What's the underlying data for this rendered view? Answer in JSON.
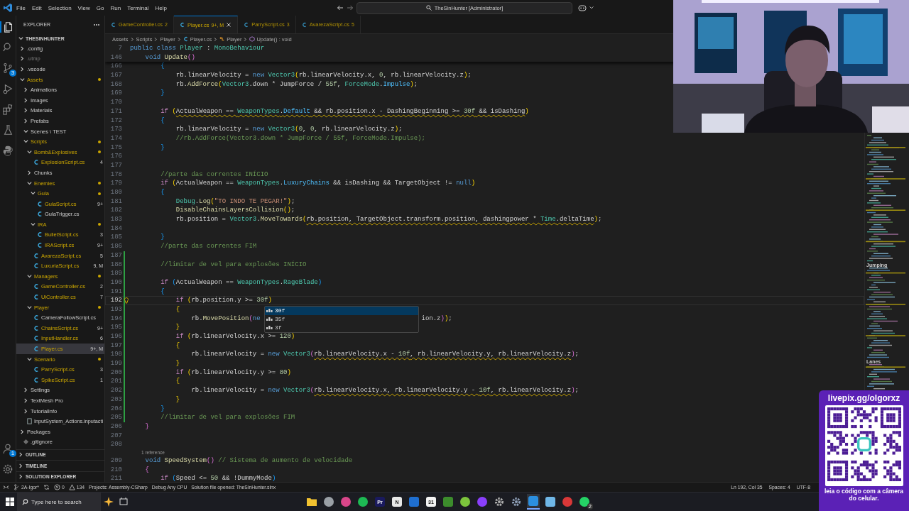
{
  "titlebar": {
    "menu": [
      "File",
      "Edit",
      "Selection",
      "View",
      "Go",
      "Run",
      "Terminal",
      "Help"
    ],
    "command_center": "TheSinHunter [Administrator]"
  },
  "activity_bar": {
    "top": [
      {
        "kind": "explorer",
        "selected": true
      },
      {
        "kind": "search",
        "selected": false
      },
      {
        "kind": "source-control",
        "selected": false,
        "badge": "3"
      },
      {
        "kind": "run-debug",
        "selected": false
      },
      {
        "kind": "extensions",
        "selected": false
      },
      {
        "kind": "testing",
        "selected": false
      },
      {
        "kind": "python",
        "selected": false
      }
    ],
    "bottom": [
      {
        "kind": "account",
        "badge": "1"
      },
      {
        "kind": "settings"
      }
    ]
  },
  "explorer": {
    "title": "EXPLORER",
    "project": "THESINHUNTER",
    "items": [
      {
        "label": ".config",
        "kind": "folder",
        "expanded": false,
        "warning": false,
        "ignored": false,
        "dot": false,
        "selected": false
      },
      {
        "label": ".utmp",
        "kind": "folder",
        "expanded": false,
        "warning": false,
        "ignored": true,
        "dot": false,
        "selected": false
      },
      {
        "label": ".vscode",
        "kind": "folder",
        "expanded": false,
        "warning": false,
        "ignored": false,
        "dot": false,
        "selected": false
      },
      {
        "label": "Assets",
        "kind": "folder",
        "expanded": true,
        "warning": true,
        "ignored": false,
        "dot": true,
        "selected": false,
        "children": [
          {
            "label": "Animations",
            "kind": "folder",
            "expanded": false,
            "warning": false,
            "ignored": false,
            "dot": false,
            "selected": false
          },
          {
            "label": "Images",
            "kind": "folder",
            "expanded": false,
            "warning": false,
            "ignored": false,
            "dot": false,
            "selected": false
          },
          {
            "label": "Materials",
            "kind": "folder",
            "expanded": false,
            "warning": false,
            "ignored": false,
            "dot": false,
            "selected": false
          },
          {
            "label": "Prefabs",
            "kind": "folder",
            "expanded": false,
            "warning": false,
            "ignored": false,
            "dot": false,
            "selected": false
          },
          {
            "label": "Scenes \\ TEST",
            "kind": "folder",
            "expanded": true,
            "warning": false,
            "ignored": false,
            "dot": false,
            "selected": false
          },
          {
            "label": "Scripts",
            "kind": "folder",
            "expanded": true,
            "warning": true,
            "ignored": false,
            "dot": true,
            "selected": false,
            "children": [
              {
                "label": "Bomb&Explosives",
                "kind": "folder",
                "expanded": true,
                "warning": true,
                "ignored": false,
                "dot": true,
                "selected": false,
                "children": [
                  {
                    "label": "ExplosionScript.cs",
                    "kind": "cs",
                    "warning": true,
                    "ignored": false,
                    "badge": "4",
                    "dot": false,
                    "selected": false
                  }
                ]
              },
              {
                "label": "Chunks",
                "kind": "folder",
                "expanded": false,
                "warning": false,
                "ignored": false,
                "dot": false,
                "selected": false
              },
              {
                "label": "Enemies",
                "kind": "folder",
                "expanded": true,
                "warning": true,
                "ignored": false,
                "dot": true,
                "selected": false,
                "children": [
                  {
                    "label": "Gula",
                    "kind": "folder",
                    "expanded": true,
                    "warning": true,
                    "ignored": false,
                    "dot": true,
                    "selected": false,
                    "children": [
                      {
                        "label": "GulaScript.cs",
                        "kind": "cs",
                        "warning": true,
                        "ignored": false,
                        "badge": "9+",
                        "dot": false,
                        "selected": false
                      },
                      {
                        "label": "GulaTrigger.cs",
                        "kind": "cs",
                        "warning": false,
                        "ignored": false,
                        "dot": false,
                        "selected": false
                      }
                    ]
                  },
                  {
                    "label": "IRA",
                    "kind": "folder",
                    "expanded": true,
                    "warning": true,
                    "ignored": false,
                    "dot": true,
                    "selected": false,
                    "children": [
                      {
                        "label": "BulletScript.cs",
                        "kind": "cs",
                        "warning": true,
                        "ignored": false,
                        "badge": "3",
                        "dot": false,
                        "selected": false
                      },
                      {
                        "label": "IRAScript.cs",
                        "kind": "cs",
                        "warning": true,
                        "ignored": false,
                        "badge": "9+",
                        "dot": false,
                        "selected": false
                      }
                    ]
                  },
                  {
                    "label": "AvarezaScript.cs",
                    "kind": "cs",
                    "warning": true,
                    "ignored": false,
                    "badge": "5",
                    "dot": false,
                    "selected": false
                  },
                  {
                    "label": "LuxuriaScript.cs",
                    "kind": "cs",
                    "warning": true,
                    "ignored": false,
                    "badge": "9, M",
                    "dot": false,
                    "selected": false
                  }
                ]
              },
              {
                "label": "Managers",
                "kind": "folder",
                "expanded": true,
                "warning": true,
                "ignored": false,
                "dot": true,
                "selected": false,
                "children": [
                  {
                    "label": "GameController.cs",
                    "kind": "cs",
                    "warning": true,
                    "ignored": false,
                    "badge": "2",
                    "dot": false,
                    "selected": false
                  },
                  {
                    "label": "UiController.cs",
                    "kind": "cs",
                    "warning": true,
                    "ignored": false,
                    "badge": "7",
                    "dot": false,
                    "selected": false
                  }
                ]
              },
              {
                "label": "Player",
                "kind": "folder",
                "expanded": true,
                "warning": true,
                "ignored": false,
                "dot": true,
                "selected": false,
                "children": [
                  {
                    "label": "CameraFollowScript.cs",
                    "kind": "cs",
                    "warning": false,
                    "ignored": false,
                    "dot": false,
                    "selected": false
                  },
                  {
                    "label": "ChainsScript.cs",
                    "kind": "cs",
                    "warning": true,
                    "ignored": false,
                    "badge": "9+",
                    "dot": false,
                    "selected": false
                  },
                  {
                    "label": "InputHandler.cs",
                    "kind": "cs",
                    "warning": true,
                    "ignored": false,
                    "badge": "6",
                    "dot": false,
                    "selected": false
                  },
                  {
                    "label": "Player.cs",
                    "kind": "cs",
                    "warning": true,
                    "ignored": false,
                    "badge": "9+, M",
                    "dot": false,
                    "selected": true
                  }
                ]
              },
              {
                "label": "Scenario",
                "kind": "folder",
                "expanded": true,
                "warning": true,
                "ignored": false,
                "dot": true,
                "selected": false,
                "children": [
                  {
                    "label": "ParryScript.cs",
                    "kind": "cs",
                    "warning": true,
                    "ignored": false,
                    "badge": "3",
                    "dot": false,
                    "selected": false
                  },
                  {
                    "label": "SpikeScript.cs",
                    "kind": "cs",
                    "warning": true,
                    "ignored": false,
                    "badge": "1",
                    "dot": false,
                    "selected": false
                  }
                ]
              }
            ]
          },
          {
            "label": "Settings",
            "kind": "folder",
            "expanded": false,
            "warning": false,
            "ignored": false,
            "dot": false,
            "selected": false
          },
          {
            "label": "TextMesh Pro",
            "kind": "folder",
            "expanded": false,
            "warning": false,
            "ignored": false,
            "dot": false,
            "selected": false
          },
          {
            "label": "TutorialInfo",
            "kind": "folder",
            "expanded": false,
            "warning": false,
            "ignored": false,
            "dot": false,
            "selected": false
          },
          {
            "label": "InputSystem_Actions.inputacti",
            "kind": "asset",
            "warning": false,
            "ignored": false,
            "dot": false,
            "selected": false
          }
        ]
      },
      {
        "label": "Packages",
        "kind": "folder",
        "expanded": false,
        "warning": false,
        "ignored": false,
        "dot": false,
        "selected": false
      },
      {
        "label": ".gitignore",
        "kind": "gitignore",
        "warning": false,
        "ignored": false,
        "dot": false,
        "selected": false
      }
    ],
    "sections": [
      "OUTLINE",
      "TIMELINE",
      "SOLUTION EXPLORER"
    ]
  },
  "tabs": [
    {
      "label": "GameController.cs",
      "badge": "2",
      "selected": false
    },
    {
      "label": "Player.cs",
      "badge": "9+, M",
      "selected": true
    },
    {
      "label": "ParryScript.cs",
      "badge": "3",
      "selected": false
    },
    {
      "label": "AvarezaScript.cs",
      "badge": "5",
      "selected": false
    }
  ],
  "breadcrumb": [
    {
      "label": "Assets",
      "kind": "folder"
    },
    {
      "label": "Scripts",
      "kind": "folder"
    },
    {
      "label": "Player",
      "kind": "folder"
    },
    {
      "label": "Player.cs",
      "kind": "cs"
    },
    {
      "label": "Player",
      "kind": "class"
    },
    {
      "label": "Update() : void",
      "kind": "method"
    }
  ],
  "editor": {
    "sticky": [
      {
        "n": "7",
        "tokens": [
          {
            "kind": "keyword",
            "text": "public "
          },
          {
            "kind": "keyword",
            "text": "class "
          },
          {
            "kind": "type",
            "text": "Player"
          },
          {
            "kind": "plain",
            "text": " : "
          },
          {
            "kind": "type",
            "text": "MonoBehaviour"
          }
        ]
      },
      {
        "n": "146",
        "tokens": [
          {
            "kind": "keyword",
            "text": "    void "
          },
          {
            "kind": "method",
            "text": "Update"
          },
          {
            "kind": "orchid",
            "text": "()"
          }
        ]
      }
    ],
    "lines": [
      {
        "n": "166",
        "current": false,
        "changed": false,
        "tokens": [
          {
            "kind": "azure",
            "text": "        {"
          }
        ]
      },
      {
        "n": "167",
        "current": false,
        "changed": false,
        "tokens": [
          {
            "kind": "plain",
            "text": "            rb.linearVelocity = "
          },
          {
            "kind": "keyword",
            "text": "new "
          },
          {
            "kind": "type",
            "text": "Vector3"
          },
          {
            "kind": "gold",
            "text": "("
          },
          {
            "kind": "plain",
            "text": "rb.linearVelocity.x, "
          },
          {
            "kind": "number",
            "text": "0"
          },
          {
            "kind": "plain",
            "text": ", rb.linearVelocity.z"
          },
          {
            "kind": "gold",
            "text": ")"
          },
          {
            "kind": "plain",
            "text": ";"
          }
        ]
      },
      {
        "n": "168",
        "current": false,
        "changed": false,
        "tokens": [
          {
            "kind": "plain",
            "text": "            rb."
          },
          {
            "kind": "method",
            "text": "AddForce"
          },
          {
            "kind": "gold",
            "text": "("
          },
          {
            "kind": "type",
            "text": "Vector3"
          },
          {
            "kind": "plain",
            "text": ".down * JumpForce / "
          },
          {
            "kind": "number",
            "text": "55f"
          },
          {
            "kind": "plain",
            "text": ", "
          },
          {
            "kind": "type",
            "text": "ForceMode"
          },
          {
            "kind": "plain",
            "text": "."
          },
          {
            "kind": "member",
            "text": "Impulse"
          },
          {
            "kind": "gold",
            "text": ")"
          },
          {
            "kind": "plain",
            "text": ";"
          }
        ]
      },
      {
        "n": "169",
        "current": false,
        "changed": false,
        "tokens": [
          {
            "kind": "azure",
            "text": "        }"
          }
        ]
      },
      {
        "n": "170",
        "current": false,
        "changed": false
      },
      {
        "n": "171",
        "current": false,
        "changed": false,
        "tokens": [
          {
            "kind": "control",
            "text": "        if ",
            "squiggle": false
          },
          {
            "kind": "gold",
            "text": "(",
            "squiggle": false
          },
          {
            "kind": "plain",
            "text": "ActualWeapon == ",
            "squiggle": true
          },
          {
            "kind": "type",
            "text": "WeaponTypes",
            "squiggle": true
          },
          {
            "kind": "plain",
            "text": ".",
            "squiggle": true
          },
          {
            "kind": "member",
            "text": "Default",
            "squiggle": true
          },
          {
            "kind": "plain",
            "text": " && rb.position.x - DashingBeginning >= ",
            "squiggle": true
          },
          {
            "kind": "number",
            "text": "30f",
            "squiggle": true
          },
          {
            "kind": "plain",
            "text": " && isDashing",
            "squiggle": true
          },
          {
            "kind": "gold",
            "text": ")",
            "squiggle": false
          }
        ]
      },
      {
        "n": "172",
        "current": false,
        "changed": false,
        "tokens": [
          {
            "kind": "azure",
            "text": "        {"
          }
        ]
      },
      {
        "n": "173",
        "current": false,
        "changed": false,
        "tokens": [
          {
            "kind": "plain",
            "text": "            rb.linearVelocity = "
          },
          {
            "kind": "keyword",
            "text": "new "
          },
          {
            "kind": "type",
            "text": "Vector3"
          },
          {
            "kind": "gold",
            "text": "("
          },
          {
            "kind": "number",
            "text": "0"
          },
          {
            "kind": "plain",
            "text": ", "
          },
          {
            "kind": "number",
            "text": "0"
          },
          {
            "kind": "plain",
            "text": ", rb.linearVelocity.z"
          },
          {
            "kind": "gold",
            "text": ")"
          },
          {
            "kind": "plain",
            "text": ";"
          }
        ]
      },
      {
        "n": "174",
        "current": false,
        "changed": false,
        "tokens": [
          {
            "kind": "comment",
            "text": "            //rb.AddForce(Vector3.down * JumpForce / 55f, ForceMode.Impulse);"
          }
        ]
      },
      {
        "n": "175",
        "current": false,
        "changed": false,
        "tokens": [
          {
            "kind": "azure",
            "text": "        }"
          }
        ]
      },
      {
        "n": "176",
        "current": false,
        "changed": false
      },
      {
        "n": "177",
        "current": false,
        "changed": false
      },
      {
        "n": "178",
        "current": false,
        "changed": false,
        "tokens": [
          {
            "kind": "comment",
            "text": "        //parte das correntes INÍCIO"
          }
        ]
      },
      {
        "n": "179",
        "current": false,
        "changed": false,
        "tokens": [
          {
            "kind": "control",
            "text": "        if "
          },
          {
            "kind": "gold",
            "text": "("
          },
          {
            "kind": "plain",
            "text": "ActualWeapon == "
          },
          {
            "kind": "type",
            "text": "WeaponTypes"
          },
          {
            "kind": "plain",
            "text": "."
          },
          {
            "kind": "member",
            "text": "LuxuryChains"
          },
          {
            "kind": "plain",
            "text": " && isDashing && TargetObject != "
          },
          {
            "kind": "keyword",
            "text": "null"
          },
          {
            "kind": "gold",
            "text": ")"
          }
        ]
      },
      {
        "n": "180",
        "current": false,
        "changed": false,
        "tokens": [
          {
            "kind": "azure",
            "text": "        {"
          }
        ]
      },
      {
        "n": "181",
        "current": false,
        "changed": false,
        "tokens": [
          {
            "kind": "type",
            "text": "            Debug"
          },
          {
            "kind": "plain",
            "text": "."
          },
          {
            "kind": "method",
            "text": "Log"
          },
          {
            "kind": "gold",
            "text": "("
          },
          {
            "kind": "string",
            "text": "\"TO INDO TE PEGAR!\""
          },
          {
            "kind": "gold",
            "text": ")"
          },
          {
            "kind": "plain",
            "text": ";"
          }
        ]
      },
      {
        "n": "182",
        "current": false,
        "changed": false,
        "tokens": [
          {
            "kind": "method",
            "text": "            DisableChainsLayersCollision"
          },
          {
            "kind": "gold",
            "text": "()"
          },
          {
            "kind": "plain",
            "text": ";"
          }
        ]
      },
      {
        "n": "183",
        "current": false,
        "changed": false,
        "tokens": [
          {
            "kind": "plain",
            "text": "            rb.position = ",
            "squiggle": false
          },
          {
            "kind": "type",
            "text": "Vector3",
            "squiggle": false
          },
          {
            "kind": "plain",
            "text": ".",
            "squiggle": false
          },
          {
            "kind": "method",
            "text": "MoveTowards",
            "squiggle": false
          },
          {
            "kind": "gold",
            "text": "(",
            "squiggle": false
          },
          {
            "kind": "plain",
            "text": "rb.position, TargetObject.transform.position, dashingpower * ",
            "squiggle": true
          },
          {
            "kind": "type",
            "text": "Time",
            "squiggle": true
          },
          {
            "kind": "plain",
            "text": ".deltaTime",
            "squiggle": true
          },
          {
            "kind": "gold",
            "text": ")",
            "squiggle": false
          },
          {
            "kind": "plain",
            "text": ";",
            "squiggle": false
          }
        ]
      },
      {
        "n": "184",
        "current": false,
        "changed": false
      },
      {
        "n": "185",
        "current": false,
        "changed": false,
        "tokens": [
          {
            "kind": "azure",
            "text": "        }"
          }
        ]
      },
      {
        "n": "186",
        "current": false,
        "changed": false,
        "tokens": [
          {
            "kind": "comment",
            "text": "        //parte das correntes FIM"
          }
        ]
      },
      {
        "n": "187",
        "current": false,
        "changed": true
      },
      {
        "n": "188",
        "current": false,
        "changed": true,
        "tokens": [
          {
            "kind": "comment",
            "text": "        //limitar de vel para explosões INÍCIO"
          }
        ]
      },
      {
        "n": "189",
        "current": false,
        "changed": true
      },
      {
        "n": "190",
        "current": false,
        "changed": true,
        "tokens": [
          {
            "kind": "control",
            "text": "        if "
          },
          {
            "kind": "azure",
            "text": "("
          },
          {
            "kind": "plain",
            "text": "ActualWeapon == "
          },
          {
            "kind": "type",
            "text": "WeaponTypes"
          },
          {
            "kind": "plain",
            "text": "."
          },
          {
            "kind": "type",
            "text": "RageBlade"
          },
          {
            "kind": "azure",
            "text": ")"
          }
        ]
      },
      {
        "n": "191",
        "current": false,
        "changed": true,
        "tokens": [
          {
            "kind": "azure",
            "text": "        {"
          }
        ]
      },
      {
        "n": "192",
        "current": true,
        "changed": true,
        "tokens": [
          {
            "kind": "control",
            "text": "            if "
          },
          {
            "kind": "gold",
            "text": "("
          },
          {
            "kind": "plain",
            "text": "rb.position.y >= "
          },
          {
            "kind": "number",
            "text": "30f"
          },
          {
            "kind": "gold",
            "text": ")"
          }
        ]
      },
      {
        "n": "193",
        "current": false,
        "changed": true,
        "tokens": [
          {
            "kind": "gold",
            "text": "            {"
          }
        ]
      },
      {
        "n": "194",
        "current": false,
        "changed": true,
        "tokens": [
          {
            "kind": "plain",
            "text": "                rb."
          },
          {
            "kind": "method",
            "text": "MovePosition"
          },
          {
            "kind": "orchid",
            "text": "("
          },
          {
            "kind": "keyword",
            "text": "ne"
          }
        ],
        "tail": [
          {
            "kind": "plain",
            "text": "ion.z"
          },
          {
            "kind": "orchid",
            "text": ")"
          },
          {
            "kind": "gold",
            "text": ")"
          },
          {
            "kind": "plain",
            "text": ";"
          }
        ]
      },
      {
        "n": "195",
        "current": false,
        "changed": true,
        "tokens": [
          {
            "kind": "gold",
            "text": "            }"
          }
        ]
      },
      {
        "n": "196",
        "current": false,
        "changed": true,
        "tokens": [
          {
            "kind": "control",
            "text": "            if "
          },
          {
            "kind": "gold",
            "text": "("
          },
          {
            "kind": "plain",
            "text": "rb.linearVelocity.x >= "
          },
          {
            "kind": "number",
            "text": "120"
          },
          {
            "kind": "gold",
            "text": ")"
          }
        ]
      },
      {
        "n": "197",
        "current": false,
        "changed": true,
        "tokens": [
          {
            "kind": "gold",
            "text": "            {"
          }
        ]
      },
      {
        "n": "198",
        "current": false,
        "changed": true,
        "tokens": [
          {
            "kind": "plain",
            "text": "                rb.linearVelocity = ",
            "squiggle": false
          },
          {
            "kind": "keyword",
            "text": "new ",
            "squiggle": false
          },
          {
            "kind": "type",
            "text": "Vector3",
            "squiggle": false
          },
          {
            "kind": "orchid",
            "text": "(",
            "squiggle": false
          },
          {
            "kind": "plain",
            "text": "rb.linearVelocity.x - ",
            "squiggle": true
          },
          {
            "kind": "number",
            "text": "10f",
            "squiggle": true
          },
          {
            "kind": "plain",
            "text": ", rb.linearVelocity.y, rb.linearVelocity.z",
            "squiggle": true
          },
          {
            "kind": "orchid",
            "text": ")",
            "squiggle": false
          },
          {
            "kind": "plain",
            "text": ";",
            "squiggle": false
          }
        ]
      },
      {
        "n": "199",
        "current": false,
        "changed": true,
        "tokens": [
          {
            "kind": "gold",
            "text": "            }"
          }
        ]
      },
      {
        "n": "200",
        "current": false,
        "changed": true,
        "tokens": [
          {
            "kind": "control",
            "text": "            if "
          },
          {
            "kind": "gold",
            "text": "("
          },
          {
            "kind": "plain",
            "text": "rb.linearVelocity.y >= "
          },
          {
            "kind": "number",
            "text": "80"
          },
          {
            "kind": "gold",
            "text": ")"
          }
        ]
      },
      {
        "n": "201",
        "current": false,
        "changed": true,
        "tokens": [
          {
            "kind": "gold",
            "text": "            {"
          }
        ]
      },
      {
        "n": "202",
        "current": false,
        "changed": true,
        "tokens": [
          {
            "kind": "plain",
            "text": "                rb.linearVelocity = ",
            "squiggle": false
          },
          {
            "kind": "keyword",
            "text": "new ",
            "squiggle": false
          },
          {
            "kind": "type",
            "text": "Vector3",
            "squiggle": false
          },
          {
            "kind": "orchid",
            "text": "(",
            "squiggle": false
          },
          {
            "kind": "plain",
            "text": "rb.linearVelocity.x, rb.linearVelocity.y - ",
            "squiggle": true
          },
          {
            "kind": "number",
            "text": "10f",
            "squiggle": true
          },
          {
            "kind": "plain",
            "text": ", rb.linearVelocity.z",
            "squiggle": true
          },
          {
            "kind": "orchid",
            "text": ")",
            "squiggle": false
          },
          {
            "kind": "plain",
            "text": ";",
            "squiggle": false
          }
        ]
      },
      {
        "n": "203",
        "current": false,
        "changed": true,
        "tokens": [
          {
            "kind": "gold",
            "text": "            }"
          }
        ]
      },
      {
        "n": "204",
        "current": false,
        "changed": true,
        "tokens": [
          {
            "kind": "azure",
            "text": "        }"
          }
        ]
      },
      {
        "n": "205",
        "current": false,
        "changed": true,
        "tokens": [
          {
            "kind": "comment",
            "text": "        //limitar de vel para explosões FIM"
          }
        ]
      },
      {
        "n": "206",
        "current": false,
        "changed": false,
        "tokens": [
          {
            "kind": "orchid",
            "text": "    }"
          }
        ]
      },
      {
        "n": "207",
        "current": false,
        "changed": false
      },
      {
        "n": "208",
        "current": false,
        "changed": false
      },
      {
        "n": "209",
        "current": false,
        "changed": false,
        "codelens": "1 reference",
        "tokens": [
          {
            "kind": "keyword",
            "text": "    void "
          },
          {
            "kind": "method",
            "text": "SpeedSystem"
          },
          {
            "kind": "orchid",
            "text": "()"
          },
          {
            "kind": "comment",
            "text": " // Sistema de aumento de velocidade"
          }
        ]
      },
      {
        "n": "210",
        "current": false,
        "changed": false,
        "tokens": [
          {
            "kind": "orchid",
            "text": "    {"
          }
        ]
      },
      {
        "n": "211",
        "current": false,
        "changed": false,
        "tokens": [
          {
            "kind": "control",
            "text": "        if "
          },
          {
            "kind": "azure",
            "text": "("
          },
          {
            "kind": "plain",
            "text": "Speed <= "
          },
          {
            "kind": "number",
            "text": "50"
          },
          {
            "kind": "plain",
            "text": " && !DummyMode"
          },
          {
            "kind": "azure",
            "text": ")"
          }
        ]
      }
    ],
    "suggestions": [
      {
        "label": "30f",
        "selected": true
      },
      {
        "label": "35f",
        "selected": false
      },
      {
        "label": "3f",
        "selected": false
      }
    ],
    "minimap_labels": [
      "Jumping",
      "Lanes"
    ]
  },
  "status_bar": {
    "left": [
      {
        "kind": "remote"
      },
      {
        "kind": "branch",
        "text": "2A-Igor*"
      },
      {
        "kind": "sync"
      },
      {
        "kind": "errors",
        "text": "0"
      },
      {
        "kind": "warnings",
        "text": "134"
      },
      {
        "kind": "text",
        "text": "Projects: Assembly-CSharp"
      },
      {
        "kind": "text",
        "text": "Debug Any CPU"
      },
      {
        "kind": "text",
        "text": "Solution file opened: TheSinHunter.slnx"
      }
    ],
    "right": [
      "Ln 192, Col 35",
      "Spaces: 4",
      "UTF-8"
    ]
  },
  "taskbar": {
    "search_placeholder": "Type here to search",
    "apps": [
      {
        "kind": "folder",
        "color": "#f2c230",
        "active": false
      },
      {
        "kind": "circle",
        "color": "#9aa0a6",
        "active": false
      },
      {
        "kind": "circle",
        "color": "#d9468a",
        "active": false
      },
      {
        "kind": "circle",
        "color": "#1db954",
        "active": false
      },
      {
        "kind": "tile",
        "color": "#1a1a5e",
        "text": "Pr",
        "active": false
      },
      {
        "kind": "tile",
        "color": "#e8e8e8",
        "text": "N",
        "active": false
      },
      {
        "kind": "tile",
        "color": "#1f6fd1",
        "active": false
      },
      {
        "kind": "tile",
        "color": "#f3f3f3",
        "text": "31",
        "active": false
      },
      {
        "kind": "tile",
        "color": "#3c8c2c",
        "active": false
      },
      {
        "kind": "circle",
        "color": "#7cc43c",
        "active": false
      },
      {
        "kind": "circle",
        "color": "#8a3ffc",
        "active": false
      },
      {
        "kind": "gear",
        "color": "#b0b0b0",
        "active": false
      },
      {
        "kind": "gear",
        "color": "#8fa0b8",
        "active": false
      },
      {
        "kind": "tile",
        "color": "#2b8fe0",
        "active": true
      },
      {
        "kind": "tile",
        "color": "#6fb7e8",
        "active": false
      },
      {
        "kind": "circle",
        "color": "#d93838",
        "active": false
      },
      {
        "kind": "circle",
        "color": "#25d366",
        "badge": "2",
        "active": false
      }
    ]
  },
  "donation": {
    "url": "livepix.gg/olgorxz",
    "caption": "leia o código com a câmera do celular."
  }
}
